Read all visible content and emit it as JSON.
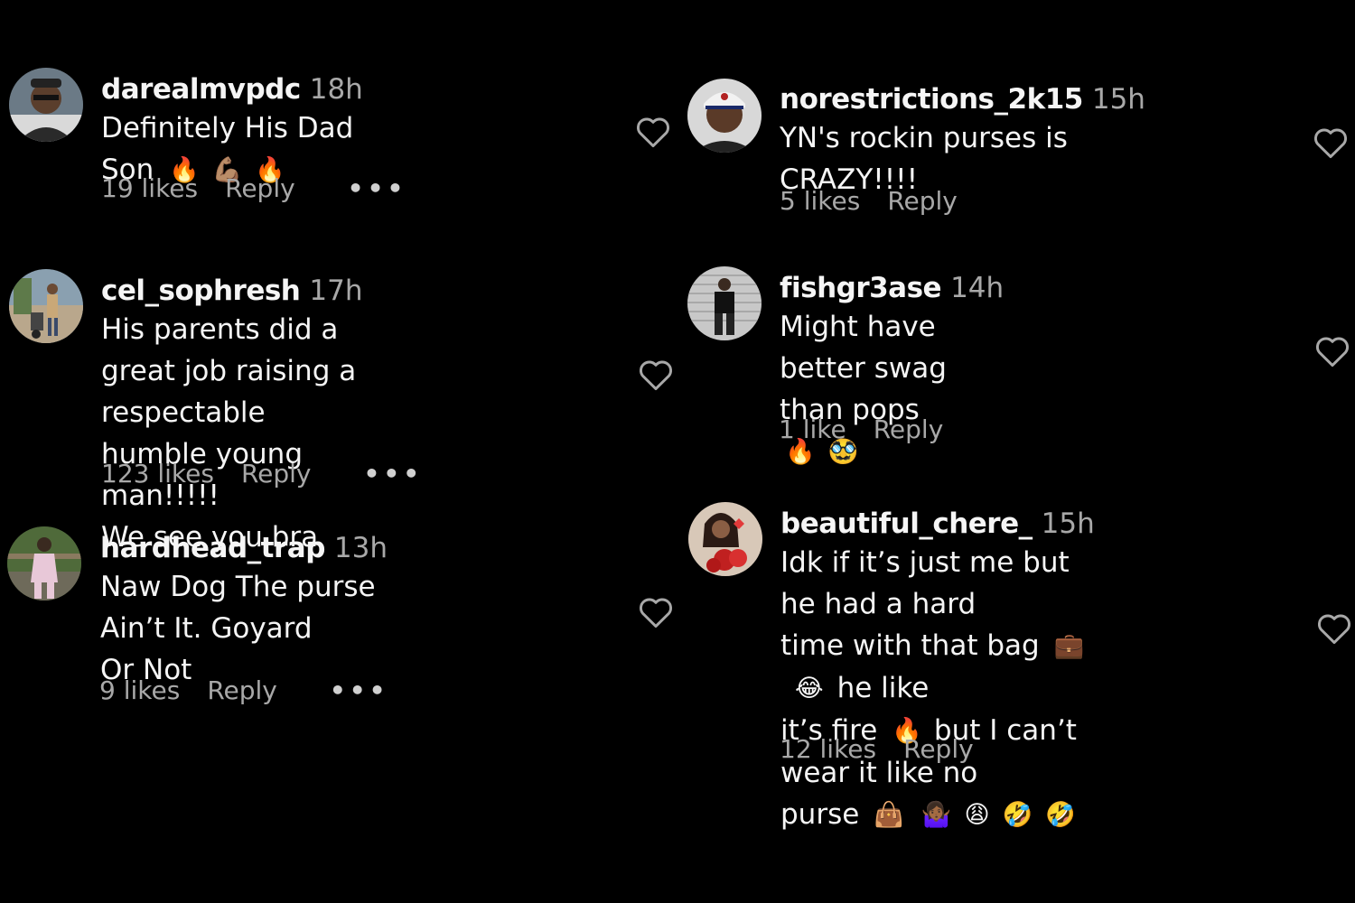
{
  "comments": [
    {
      "username": "darealmvpdc",
      "time": "18h",
      "text_segments": [
        "Definitely His Dad Son "
      ],
      "emojis": [
        "🔥",
        "💪🏽",
        "🔥"
      ],
      "likes": "19 likes",
      "reply": "Reply",
      "more": "•••"
    },
    {
      "username": "cel_sophresh",
      "time": "17h",
      "text_lines": [
        "His parents did a great job raising a",
        "respectable humble young man!!!!!",
        "We see you bra"
      ],
      "likes": "123 likes",
      "reply": "Reply",
      "more": "•••"
    },
    {
      "username": "hardhead_trap",
      "time": "13h",
      "text_lines": [
        "Naw Dog The purse Ain’t It. Goyard",
        "Or Not"
      ],
      "likes": "9 likes",
      "reply": "Reply",
      "more": "•••"
    },
    {
      "username": "norestrictions_2k15",
      "time": "15h",
      "text_lines": [
        "YN's rockin purses is CRAZY!!!!"
      ],
      "likes": "5 likes",
      "reply": "Reply"
    },
    {
      "username": "fishgr3ase",
      "time": "14h",
      "text_lines": [
        "Might have better swag than pops"
      ],
      "emojis": [
        "🔥",
        "🥸"
      ],
      "likes": "1 like",
      "reply": "Reply"
    },
    {
      "username": "beautiful_chere_",
      "time": "15h",
      "line1": "Idk if it’s just me but he had a hard",
      "line2_a": "time with that bag",
      "line2_emojis": [
        "💼",
        "😂"
      ],
      "line2_b": "he like",
      "line3_a": "it’s fire",
      "line3_emoji": "🔥",
      "line3_b": "but I can’t wear it like no",
      "line4_a": "purse",
      "line4_emojis": [
        "👜",
        "🤷🏾‍♀️",
        "😩",
        "🤣",
        "🤣"
      ],
      "likes": "12 likes",
      "reply": "Reply"
    }
  ],
  "icons": {
    "heart": "heart-outline-icon",
    "avatar": "profile-avatar"
  }
}
